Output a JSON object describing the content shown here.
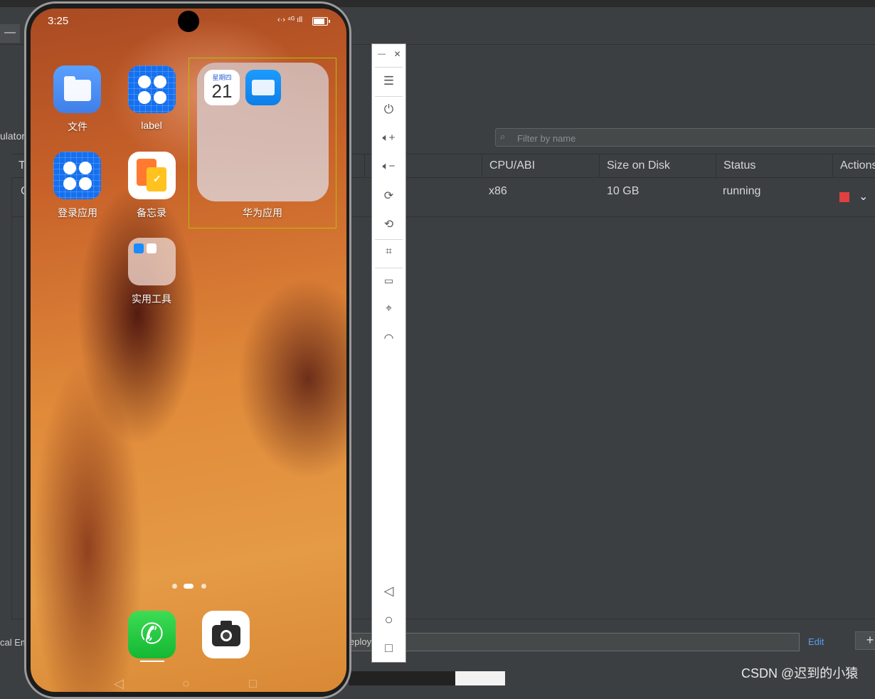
{
  "ide": {
    "side_label": "ulator",
    "filter_placeholder": "Filter by name",
    "table": {
      "headers": [
        "T",
        "CPU/ABI",
        "Size on Disk",
        "Status",
        "Actions"
      ],
      "row": {
        "first_cell": "C",
        "cpu": "x86",
        "size": "10 GB",
        "status": "running"
      }
    },
    "bottom_label": "cal Em",
    "deploy_text": "eploy",
    "edit_label": "Edit",
    "add_label": "+",
    "minimize_label": "—"
  },
  "phone": {
    "status": {
      "time": "3:25",
      "right_icons": "‹·›  ⁴ᴳ ıll"
    },
    "apps": [
      {
        "name": "files",
        "label": "文件"
      },
      {
        "name": "label-app",
        "label": "label"
      },
      {
        "name": "login-app",
        "label": "登录应用"
      },
      {
        "name": "memo",
        "label": "备忘录"
      },
      {
        "name": "tools-folder",
        "label": "实用工具"
      }
    ],
    "huawei_folder": {
      "label": "华为应用",
      "calendar": {
        "weekday": "星期四",
        "day": "21"
      }
    },
    "dock": [
      "phone",
      "camera"
    ]
  },
  "emulator_toolbar": {
    "items": [
      "minimize",
      "close",
      "menu",
      "power",
      "volume-up",
      "volume-down",
      "rotate-right",
      "rotate-left",
      "screenshot",
      "battery",
      "location",
      "wifi",
      "back",
      "home",
      "recents"
    ]
  },
  "watermark": "CSDN @迟到的小猿",
  "colors": {
    "accent_link": "#589df6",
    "stop_red": "#e04040",
    "folder_focus": "#b5c000"
  }
}
